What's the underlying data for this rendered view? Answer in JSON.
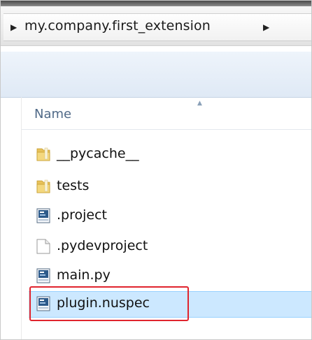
{
  "address_bar": {
    "path": "my.company.first_extension",
    "left_arrow_icon": "chevron-right-icon",
    "right_arrow_icon": "chevron-right-icon"
  },
  "columns": {
    "name_label": "Name",
    "sort": "ascending"
  },
  "files": [
    {
      "name": "__pycache__",
      "type": "folder",
      "icon": "folder-icon"
    },
    {
      "name": "tests",
      "type": "folder",
      "icon": "folder-icon"
    },
    {
      "name": ".project",
      "type": "file",
      "icon": "file-icon"
    },
    {
      "name": ".pydevproject",
      "type": "file",
      "icon": "blank-file-icon"
    },
    {
      "name": "main.py",
      "type": "file",
      "icon": "file-icon"
    },
    {
      "name": "plugin.nuspec",
      "type": "file",
      "icon": "file-icon",
      "selected": true
    }
  ],
  "colors": {
    "selection": "#cce8ff",
    "highlight": "#e0242e",
    "header_text": "#4f6987"
  }
}
